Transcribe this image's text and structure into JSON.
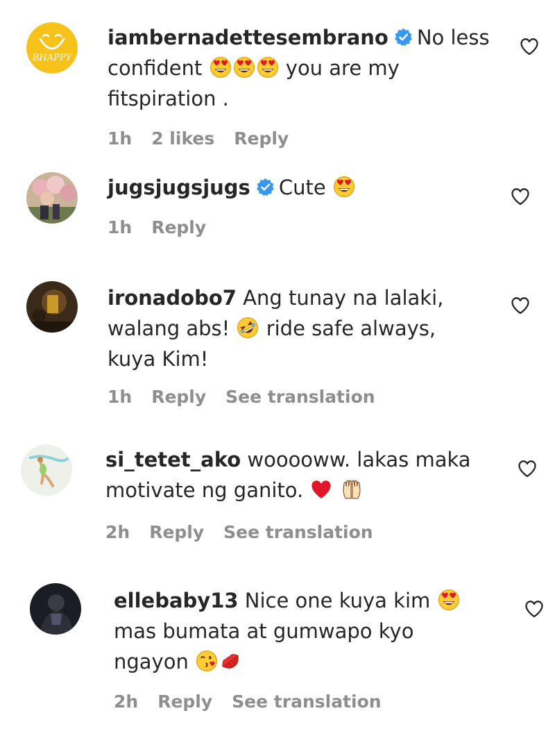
{
  "icons": {
    "verified": "verified-badge-icon",
    "heart": "heart-outline-icon",
    "heart_eyes": "heart-eyes-emoji",
    "rofl": "rolling-laughing-emoji",
    "red_heart": "red-heart-emoji",
    "raised_hands": "raised-hands-emoji",
    "winking_kiss": "face-blowing-kiss-emoji",
    "kiss_mark": "kiss-mark-emoji"
  },
  "colors": {
    "verified_blue": "#3897f0",
    "meta_gray": "#8e8e8e",
    "text": "#262626"
  },
  "comments": [
    {
      "username": "iambernadettesembrano",
      "verified": true,
      "text_1": "No less",
      "text_2": "confident",
      "text_3": "you are my",
      "text_4": "fitspiration .",
      "avatar_label": "BHAPPY",
      "time": "1h",
      "likes": "2 likes",
      "reply": "Reply"
    },
    {
      "username": "jugsjugsjugs",
      "verified": true,
      "text_1": "Cute",
      "time": "1h",
      "reply": "Reply"
    },
    {
      "username": "ironadobo7",
      "verified": false,
      "text_1": "Ang tunay na lalaki,",
      "text_2": "walang abs!",
      "text_3": "ride safe always,",
      "text_4": "kuya Kim!",
      "time": "1h",
      "reply": "Reply",
      "translate": "See translation"
    },
    {
      "username": "si_tetet_ako",
      "verified": false,
      "text_1": "wooooww. lakas maka",
      "text_2": "motivate ng ganito.",
      "time": "2h",
      "reply": "Reply",
      "translate": "See translation"
    },
    {
      "username": "ellebaby13",
      "verified": false,
      "text_1": "Nice one kuya kim",
      "text_2": "mas bumata at gumwapo kyo",
      "text_3": "ngayon",
      "time": "2h",
      "reply": "Reply",
      "translate": "See translation"
    }
  ]
}
